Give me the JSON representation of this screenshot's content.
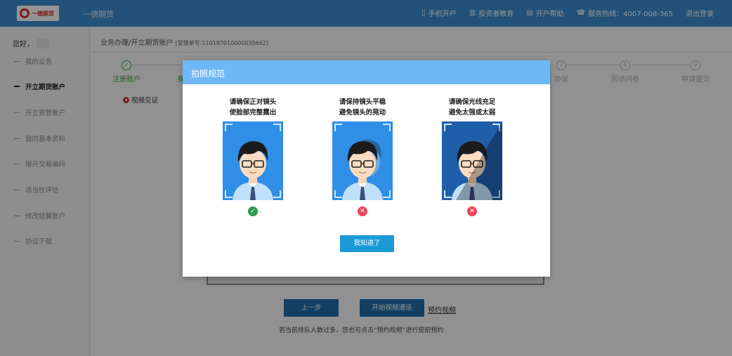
{
  "header": {
    "logo_text": "一德期货",
    "site_name": "一德期货",
    "nav": [
      {
        "icon": "phone-icon",
        "label": "手机开户"
      },
      {
        "icon": "books-icon",
        "label": "投资者教育"
      },
      {
        "icon": "document-icon",
        "label": "开户帮助"
      },
      {
        "icon": "telephone-icon",
        "label": "服务热线：4007-008-365"
      },
      {
        "icon": "",
        "label": "退出登录"
      }
    ]
  },
  "sidebar": {
    "greeting": "您好，",
    "items": [
      {
        "label": "我的业务"
      },
      {
        "label": "开立期货账户"
      },
      {
        "label": "开立资管账户"
      },
      {
        "label": "我的基本资料"
      },
      {
        "label": "增开交易编码"
      },
      {
        "label": "适当性评估"
      },
      {
        "label": "修改结算账户"
      },
      {
        "label": "协议下载"
      }
    ]
  },
  "main": {
    "breadcrumb": "业务办理/开立期货账户",
    "accept_no": "[受理单号:110197010000035662]",
    "steps": [
      {
        "num": "✓",
        "label": "注册账户",
        "state": "done"
      },
      {
        "num": "",
        "label": "身",
        "state": "done"
      },
      {
        "num": "7",
        "label": "协议",
        "state": "todo"
      },
      {
        "num": "8",
        "label": "回访问卷",
        "state": "todo"
      },
      {
        "num": "9",
        "label": "申请提交",
        "state": "todo"
      }
    ],
    "video_tip": "视频见证",
    "prev_button": "上一步",
    "start_button": "开始视频通话",
    "appointment_link": "预约视频",
    "bottom_note": "若当前排队人数过多，您也可点击“预约视频”进行提前预约"
  },
  "modal": {
    "title": "拍照规范",
    "cards": [
      {
        "line1": "请确保正对镜头",
        "line2": "使脸部完整露出",
        "status": "ok",
        "status_icon": "check-icon"
      },
      {
        "line1": "请保持镜头平稳",
        "line2": "避免镜头的晃动",
        "status": "bad",
        "status_icon": "close-icon"
      },
      {
        "line1": "请确保光线充足",
        "line2": "避免太强或太弱",
        "status": "bad",
        "status_icon": "close-icon"
      }
    ],
    "ok_button": "我知道了"
  },
  "colors": {
    "header_bg": "#3b8cd0",
    "modal_head_bg": "#6db8f7",
    "primary_button": "#1f6fae",
    "ok_button": "#1a9ad6",
    "success": "#2e9a54",
    "error": "#e84655",
    "step_done": "#3ba240"
  }
}
